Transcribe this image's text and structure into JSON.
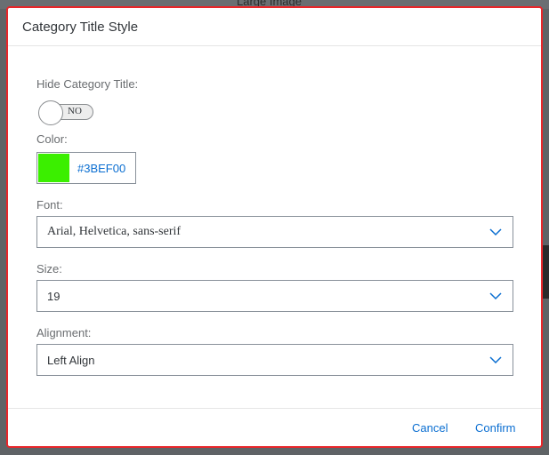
{
  "backdrop": {
    "label": "Large Image"
  },
  "dialog": {
    "title": "Category Title Style",
    "hide_title": {
      "label": "Hide Category Title:",
      "state_text": "NO",
      "checked": false
    },
    "color": {
      "label": "Color:",
      "value": "#3BEF00",
      "swatch": "#3BEF00"
    },
    "font": {
      "label": "Font:",
      "value": "Arial, Helvetica, sans-serif"
    },
    "size": {
      "label": "Size:",
      "value": "19"
    },
    "alignment": {
      "label": "Alignment:",
      "value": "Left Align"
    },
    "footer": {
      "cancel_label": "Cancel",
      "confirm_label": "Confirm"
    }
  },
  "icons": {
    "dropdown": "chevron-down-icon"
  },
  "colors": {
    "accent": "#0a6ed1",
    "dialog_border": "#e8262a"
  }
}
